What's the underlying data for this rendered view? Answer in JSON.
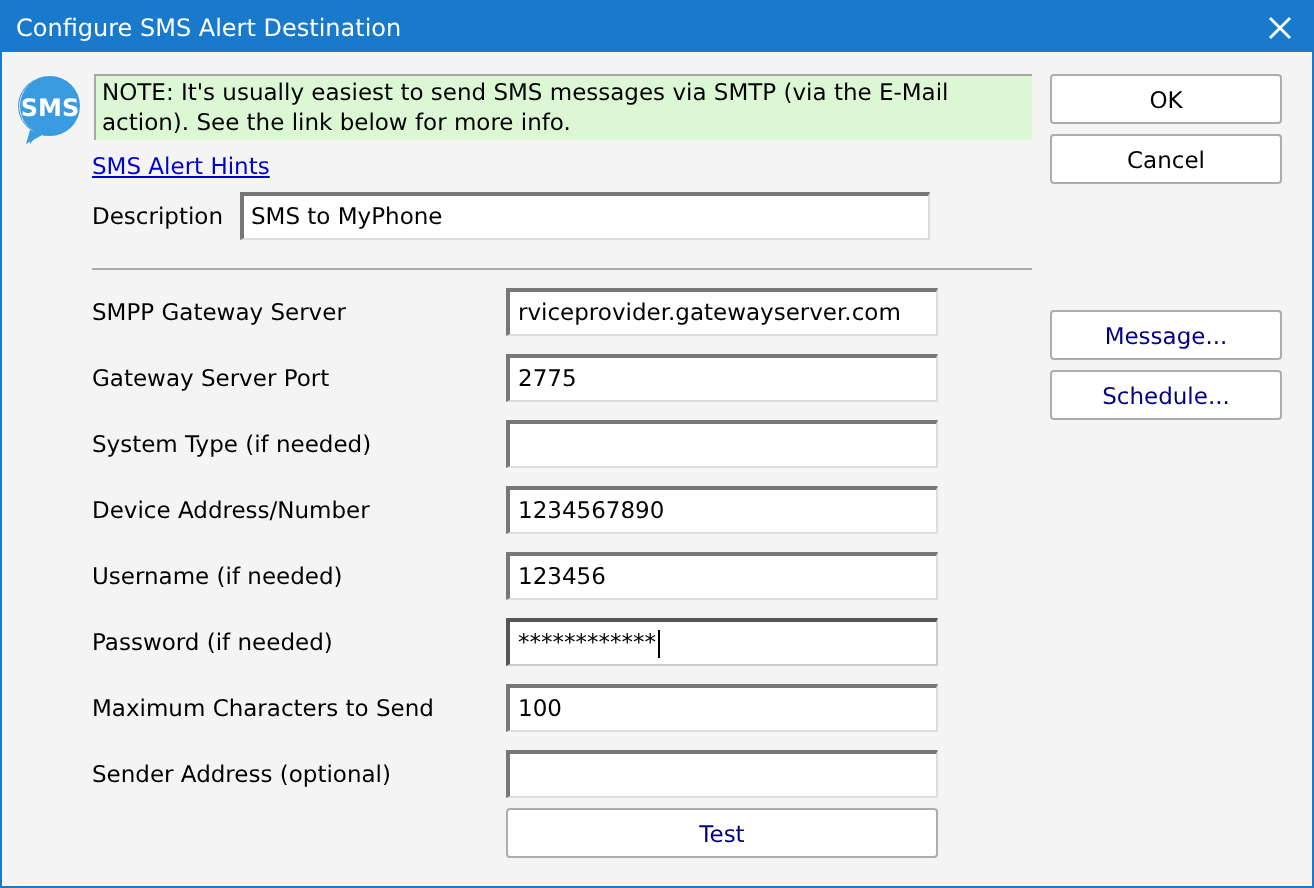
{
  "window": {
    "title": "Configure SMS Alert Destination"
  },
  "icon_text": "SMS",
  "note": "NOTE: It's usually easiest to send SMS messages via SMTP (via the E-Mail action).  See the link below for more info.",
  "hints_link": "SMS Alert Hints",
  "description": {
    "label": "Description",
    "value": "SMS to MyPhone"
  },
  "fields": [
    {
      "label": "SMPP Gateway Server",
      "value": "rviceprovider.gatewayserver.com",
      "focused": false
    },
    {
      "label": "Gateway Server Port",
      "value": "2775",
      "focused": false
    },
    {
      "label": "System Type (if needed)",
      "focused": false
    },
    {
      "label": "Device Address/Number",
      "value": "1234567890",
      "focused": false
    },
    {
      "label": "Username (if needed)",
      "value": "123456",
      "focused": false
    },
    {
      "label": "Password (if needed)",
      "value": "************",
      "focused": true
    },
    {
      "label": "Maximum Characters to Send",
      "value": "100",
      "focused": false
    },
    {
      "label": "Sender Address (optional)",
      "focused": false
    }
  ],
  "test_button": "Test",
  "buttons": [
    "OK",
    "Cancel"
  ],
  "side_buttons": [
    "Message...",
    "Schedule..."
  ]
}
